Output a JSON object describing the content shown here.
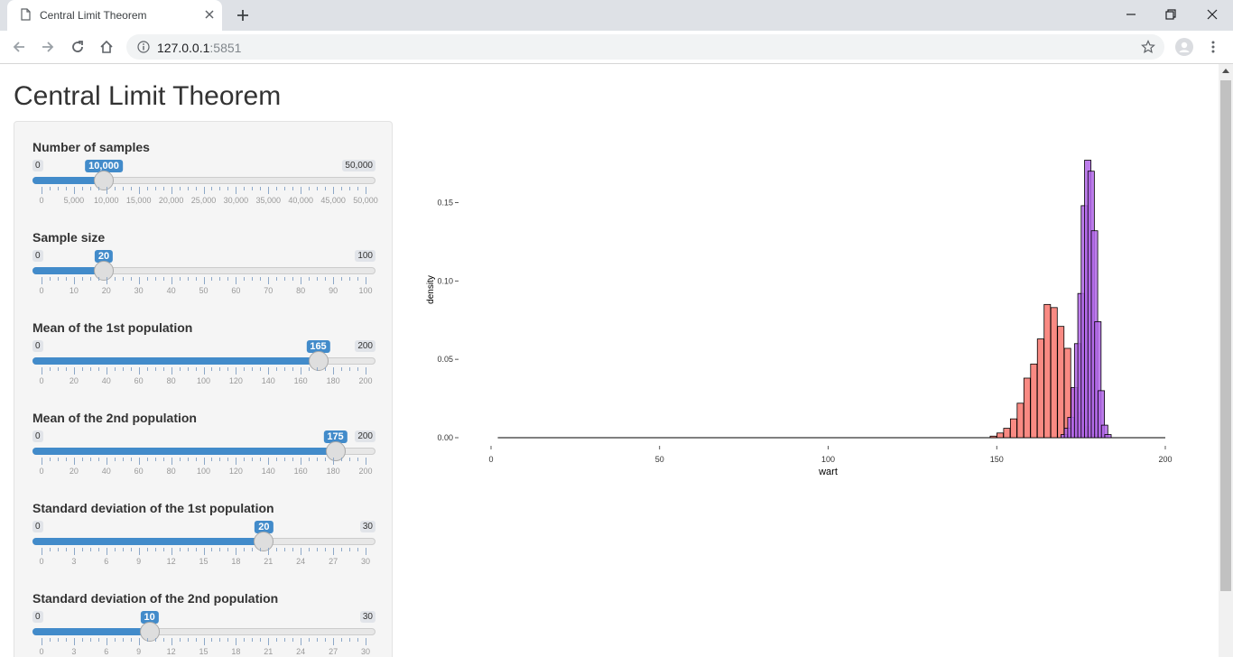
{
  "browser": {
    "tab_title": "Central Limit Theorem",
    "url_host": "127.0.0.1",
    "url_port": ":5851"
  },
  "page": {
    "title": "Central Limit Theorem"
  },
  "sliders": [
    {
      "label": "Number of samples",
      "min": "0",
      "max": "50,000",
      "value": "10,000",
      "fraction": 0.2,
      "ticks": [
        "0",
        "5,000",
        "10,000",
        "15,000",
        "20,000",
        "25,000",
        "30,000",
        "35,000",
        "40,000",
        "45,000",
        "50,000"
      ]
    },
    {
      "label": "Sample size",
      "min": "0",
      "max": "100",
      "value": "20",
      "fraction": 0.2,
      "ticks": [
        "0",
        "10",
        "20",
        "30",
        "40",
        "50",
        "60",
        "70",
        "80",
        "90",
        "100"
      ]
    },
    {
      "label": "Mean of the 1st population",
      "min": "0",
      "max": "200",
      "value": "165",
      "fraction": 0.825,
      "ticks": [
        "0",
        "20",
        "40",
        "60",
        "80",
        "100",
        "120",
        "140",
        "160",
        "180",
        "200"
      ]
    },
    {
      "label": "Mean of the 2nd population",
      "min": "0",
      "max": "200",
      "value": "175",
      "fraction": 0.875,
      "ticks": [
        "0",
        "20",
        "40",
        "60",
        "80",
        "100",
        "120",
        "140",
        "160",
        "180",
        "200"
      ]
    },
    {
      "label": "Standard deviation of the 1st population",
      "min": "0",
      "max": "30",
      "value": "20",
      "fraction": 0.6667,
      "ticks": [
        "0",
        "3",
        "6",
        "9",
        "12",
        "15",
        "18",
        "21",
        "24",
        "27",
        "30"
      ]
    },
    {
      "label": "Standard deviation of the 2nd population",
      "min": "0",
      "max": "30",
      "value": "10",
      "fraction": 0.3333,
      "ticks": [
        "0",
        "3",
        "6",
        "9",
        "12",
        "15",
        "18",
        "21",
        "24",
        "27",
        "30"
      ]
    }
  ],
  "chart_data": {
    "type": "bar",
    "xlabel": "wart",
    "ylabel": "density",
    "xlim": [
      0,
      200
    ],
    "ylim": [
      0,
      0.175
    ],
    "xticks": [
      "0",
      "50",
      "100",
      "150",
      "200"
    ],
    "yticks": [
      "0.00",
      "0.05",
      "0.10",
      "0.15"
    ],
    "bin_width": 1.9,
    "series": [
      {
        "color": "#f8766d",
        "opacity": 0.85,
        "bins": [
          {
            "x": 149,
            "y": 0.001
          },
          {
            "x": 151,
            "y": 0.003
          },
          {
            "x": 153,
            "y": 0.006
          },
          {
            "x": 155,
            "y": 0.012
          },
          {
            "x": 157,
            "y": 0.022
          },
          {
            "x": 159,
            "y": 0.038
          },
          {
            "x": 161,
            "y": 0.047
          },
          {
            "x": 163,
            "y": 0.063
          },
          {
            "x": 165,
            "y": 0.085
          },
          {
            "x": 167,
            "y": 0.083
          },
          {
            "x": 169,
            "y": 0.071
          },
          {
            "x": 171,
            "y": 0.057
          },
          {
            "x": 173,
            "y": 0.031
          },
          {
            "x": 175,
            "y": 0.016
          },
          {
            "x": 177,
            "y": 0.007
          },
          {
            "x": 179,
            "y": 0.002
          }
        ]
      },
      {
        "color": "#b266e8",
        "opacity": 0.85,
        "bins": [
          {
            "x": 170,
            "y": 0.002
          },
          {
            "x": 171,
            "y": 0.006
          },
          {
            "x": 172,
            "y": 0.013
          },
          {
            "x": 173,
            "y": 0.032
          },
          {
            "x": 174,
            "y": 0.06
          },
          {
            "x": 175,
            "y": 0.092
          },
          {
            "x": 176,
            "y": 0.148
          },
          {
            "x": 177,
            "y": 0.177
          },
          {
            "x": 178,
            "y": 0.17
          },
          {
            "x": 179,
            "y": 0.132
          },
          {
            "x": 180,
            "y": 0.074
          },
          {
            "x": 181,
            "y": 0.03
          },
          {
            "x": 182,
            "y": 0.008
          },
          {
            "x": 183,
            "y": 0.002
          }
        ]
      }
    ]
  }
}
